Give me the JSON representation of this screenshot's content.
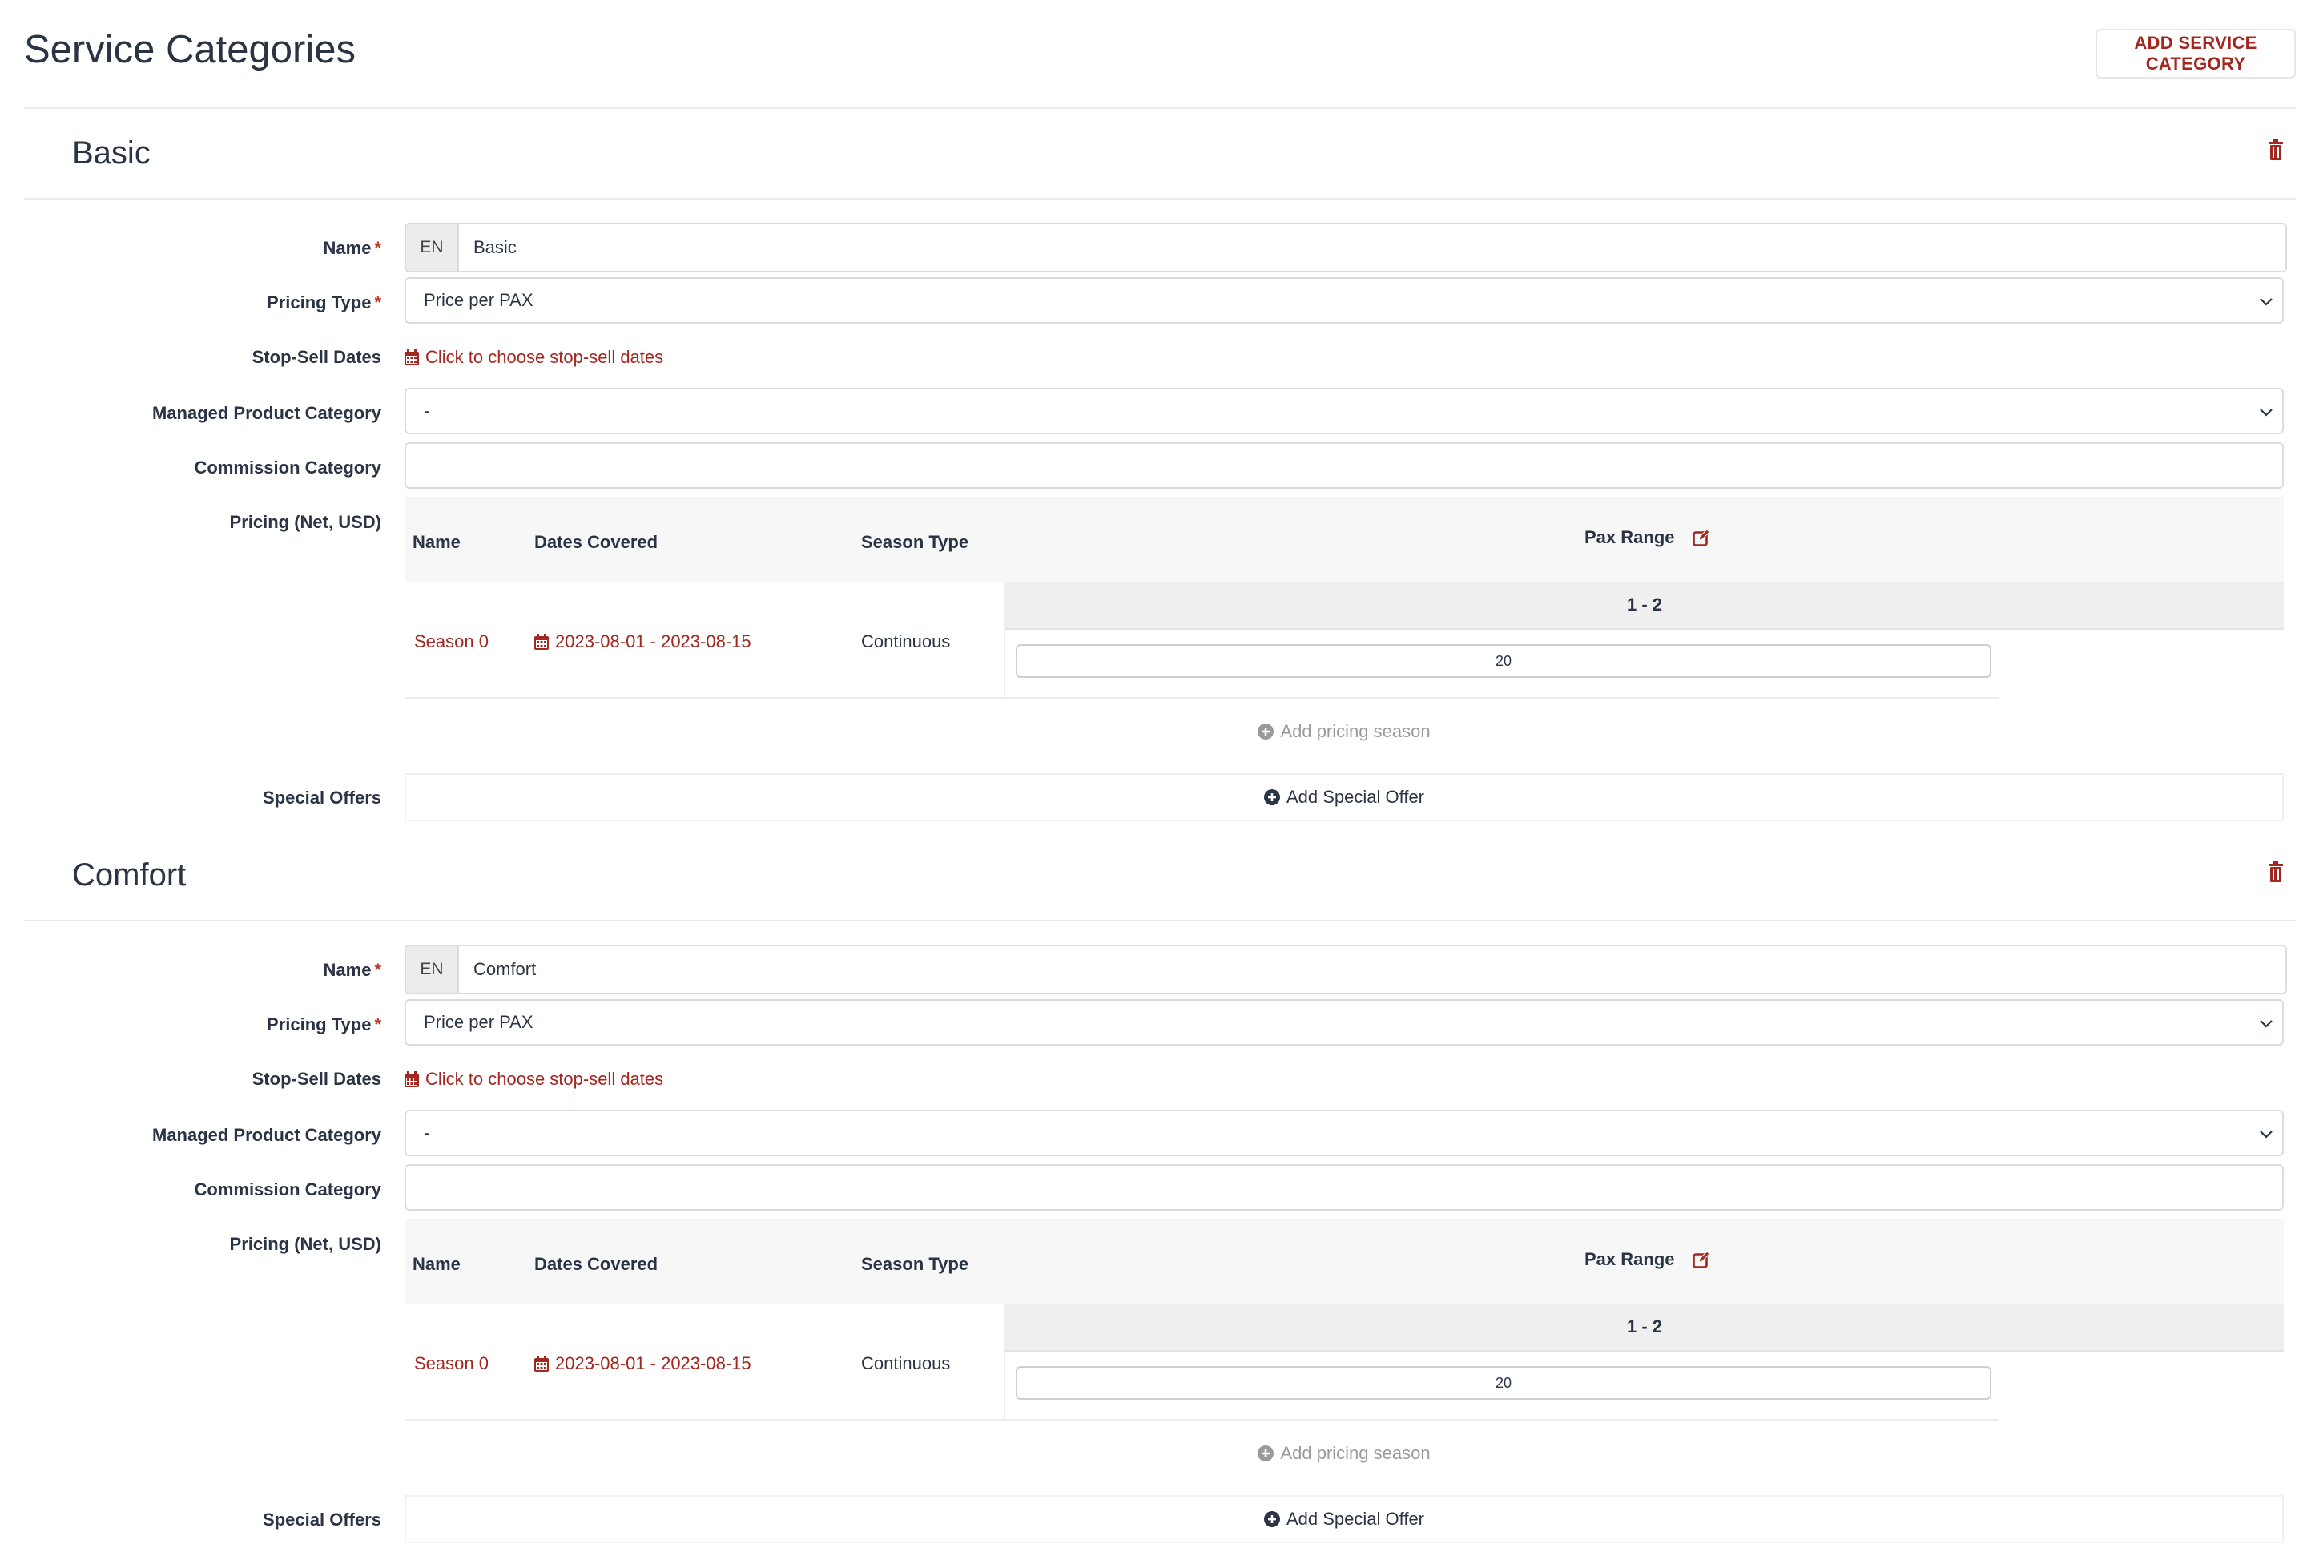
{
  "page": {
    "title": "Service Categories",
    "add_button": "ADD SERVICE CATEGORY"
  },
  "colors": {
    "accent": "#a3261f",
    "text": "#2b3445",
    "muted": "#9a9a9a"
  },
  "labels": {
    "name": "Name",
    "required_mark": "*",
    "pricing_type": "Pricing Type",
    "stop_sell": "Stop-Sell Dates",
    "managed_product": "Managed Product Category",
    "commission": "Commission Category",
    "pricing": "Pricing (Net, USD)",
    "special_offers": "Special Offers"
  },
  "table": {
    "col_name": "Name",
    "col_dates": "Dates Covered",
    "col_season_type": "Season Type",
    "col_pax_range": "Pax Range"
  },
  "categories": [
    {
      "title": "Basic",
      "lang": "EN",
      "name_value": "Basic",
      "pricing_type": "Price per PAX",
      "stop_sell_link": "Click to choose stop-sell dates",
      "managed_product": "-",
      "commission": "",
      "pax_range": "1 - 2",
      "season": {
        "name": "Season 0",
        "dates": "2023-08-01 - 2023-08-15",
        "type": "Continuous",
        "price": "20"
      },
      "add_season": "Add pricing season",
      "add_offer": "Add Special Offer"
    },
    {
      "title": "Comfort",
      "lang": "EN",
      "name_value": "Comfort",
      "pricing_type": "Price per PAX",
      "stop_sell_link": "Click to choose stop-sell dates",
      "managed_product": "-",
      "commission": "",
      "pax_range": "1 - 2",
      "season": {
        "name": "Season 0",
        "dates": "2023-08-01 - 2023-08-15",
        "type": "Continuous",
        "price": "20"
      },
      "add_season": "Add pricing season",
      "add_offer": "Add Special Offer"
    }
  ]
}
